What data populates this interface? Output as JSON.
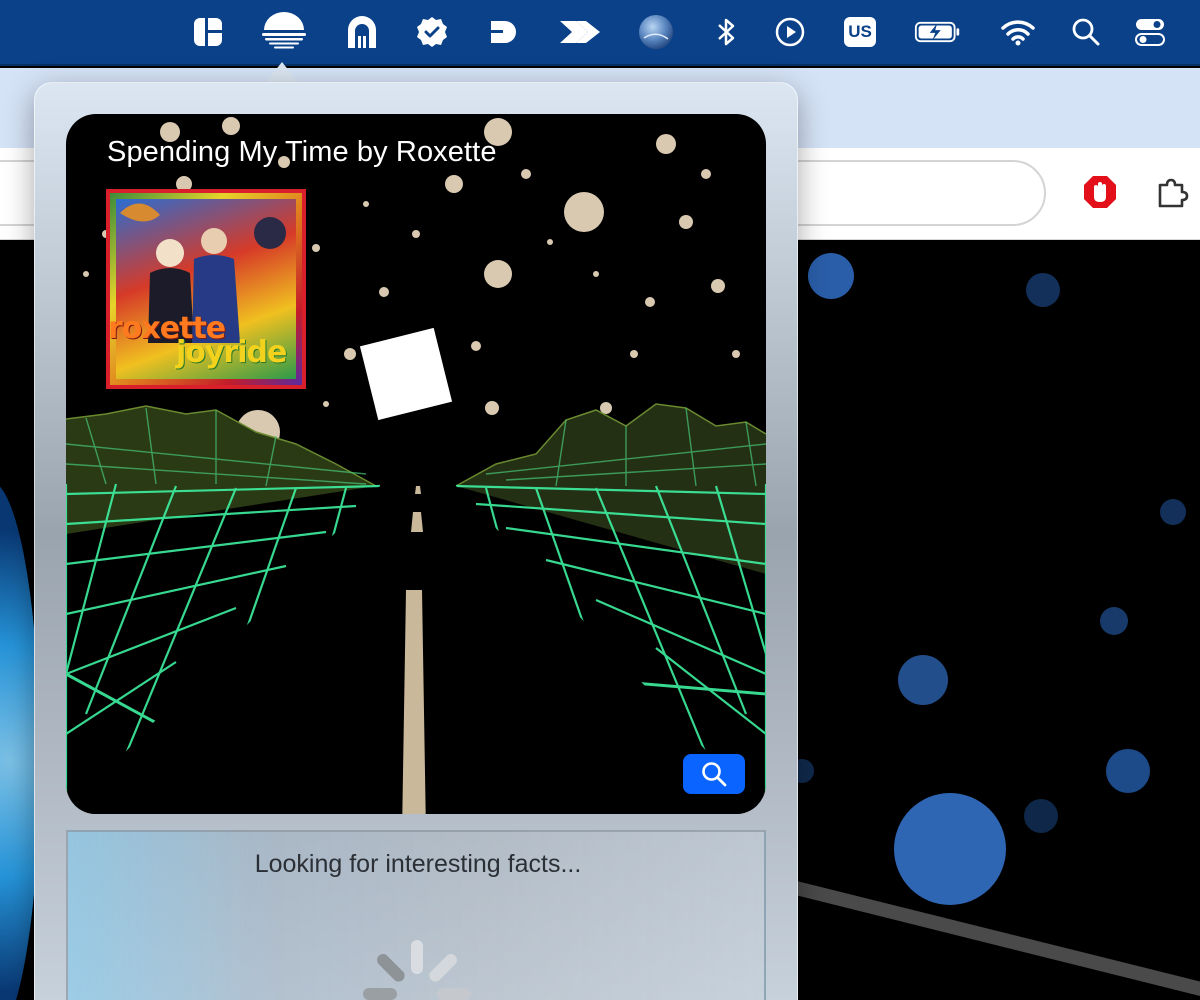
{
  "menubar": {
    "items": [
      {
        "id": "layout-app",
        "icon": "grid-layout-icon"
      },
      {
        "id": "music-visualizer",
        "icon": "sunset-icon",
        "active": true
      },
      {
        "id": "tunnel-app",
        "icon": "arch-icon"
      },
      {
        "id": "tasks-app",
        "icon": "check-badge-icon"
      },
      {
        "id": "d-app",
        "icon": "letter-d-icon"
      },
      {
        "id": "arrow-app",
        "icon": "double-arrow-icon"
      },
      {
        "id": "globe-app",
        "icon": "globe-icon"
      },
      {
        "id": "bluetooth",
        "icon": "bluetooth-icon"
      },
      {
        "id": "now-playing",
        "icon": "play-circle-icon"
      },
      {
        "id": "input-source",
        "icon": "keyboard-layout-icon",
        "label": "US"
      },
      {
        "id": "battery",
        "icon": "battery-charging-icon"
      },
      {
        "id": "wifi",
        "icon": "wifi-icon"
      },
      {
        "id": "spotlight",
        "icon": "search-icon"
      },
      {
        "id": "control-center",
        "icon": "control-center-icon"
      }
    ]
  },
  "popover": {
    "track_title": "Spending My Time by Roxette",
    "album": {
      "artist_text": "roxette",
      "title_text": "joyride"
    },
    "search_button_icon": "search-icon",
    "facts_status": "Looking for interesting facts..."
  },
  "colors": {
    "menubar_bg": "#0a4189",
    "accent_blue": "#0a64ff",
    "neon_grid": "#3df0a0",
    "road": "#c9b89a",
    "album_border": "#d81f2a"
  }
}
